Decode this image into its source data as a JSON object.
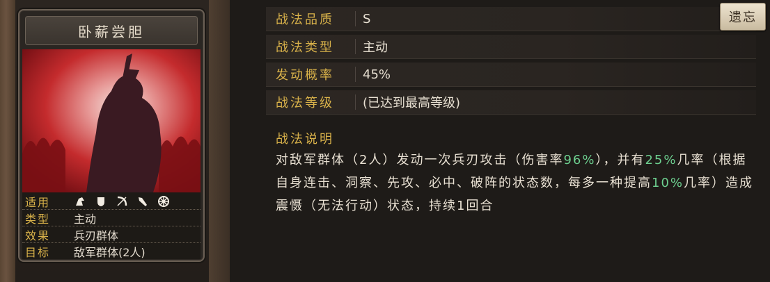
{
  "card": {
    "title": "卧薪尝胆",
    "info": [
      {
        "label": "适用",
        "value": ""
      },
      {
        "label": "类型",
        "value": "主动"
      },
      {
        "label": "效果",
        "value": "兵刃群体"
      },
      {
        "label": "目标",
        "value": "敌军群体(2人)"
      }
    ],
    "applicable_icons": [
      "cavalry-icon",
      "shield-icon",
      "bow-icon",
      "spear-icon",
      "siege-wheel-icon"
    ]
  },
  "properties": [
    {
      "label": "战法品质",
      "value": "S"
    },
    {
      "label": "战法类型",
      "value": "主动"
    },
    {
      "label": "发动概率",
      "value": "45%"
    },
    {
      "label": "战法等级",
      "value": "(已达到最高等级)"
    }
  ],
  "lose_button": "遗忘",
  "description": {
    "title": "战法说明",
    "parts": [
      {
        "text": "对敌军群体（2人）发动一次兵刃攻击（伤害率",
        "hl": false
      },
      {
        "text": "96%",
        "hl": true
      },
      {
        "text": "），并有",
        "hl": false
      },
      {
        "text": "25%",
        "hl": true
      },
      {
        "text": "几率（根据自身连击、洞察、先攻、必中、破阵的状态数，每多一种提高",
        "hl": false
      },
      {
        "text": "10%",
        "hl": true
      },
      {
        "text": "几率）造成震慑（无法行动）状态，持续1回合",
        "hl": false
      }
    ]
  },
  "colors": {
    "label_gold": "#d9b24a",
    "highlight_green": "#6dcf8f",
    "text": "#e8e0d2"
  }
}
